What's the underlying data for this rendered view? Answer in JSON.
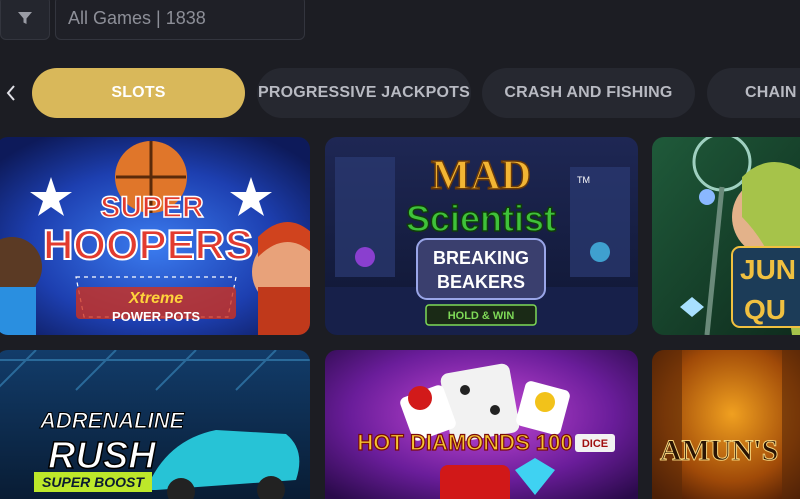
{
  "filter": {
    "icon": "filter-icon",
    "search_value": "All Games | 1838"
  },
  "tabs": [
    {
      "label": "SLOTS",
      "active": true
    },
    {
      "label": "PROGRESSIVE JACKPOTS",
      "active": false
    },
    {
      "label": "CRASH AND FISHING",
      "active": false
    },
    {
      "label": "CHAIN",
      "active": false
    }
  ],
  "games": [
    {
      "name": "SUPER HOOPERS",
      "line1": "SUPER",
      "line2": "HOOPERS",
      "sub1": "Xtreme",
      "sub2": "POWER POTS"
    },
    {
      "name": "MAD SCIENTIST BREAKING BEAKERS",
      "line1": "MAD",
      "line2": "Scientist",
      "sub1": "BREAKING",
      "sub2": "BEAKERS",
      "badge": "HOLD & WIN",
      "tm": "TM"
    },
    {
      "name": "JUNGLE QUEEN",
      "line1": "JUN",
      "line2": "QU"
    },
    {
      "name": "ADRENALINE RUSH SUPER BOOST",
      "line1": "ADRENALINE",
      "line2": "RUSH",
      "sub1": "SUPER BOOST"
    },
    {
      "name": "HOT DIAMONDS 100 DICE",
      "line1": "HOT DIAMONDS 100",
      "badge": "DICE"
    },
    {
      "name": "AMUN'S BOOK",
      "line1": "AMUN'S"
    }
  ],
  "colors": {
    "accent": "#d9b85a",
    "background": "#1c1d23",
    "tab_bg": "#262830"
  }
}
